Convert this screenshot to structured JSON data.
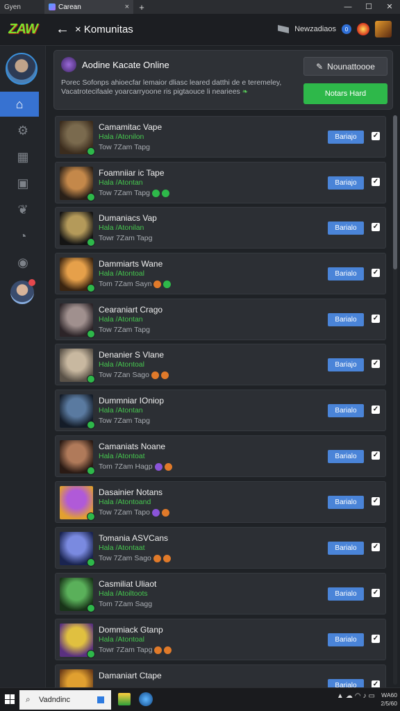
{
  "browser": {
    "tab1_label": "Gyen",
    "tab2_label": "Carean",
    "new_tab": "+",
    "close_tab": "×",
    "window_controls": [
      "—",
      "☐",
      "✕"
    ]
  },
  "app": {
    "logo_text": "ZAW",
    "page_title": "× Komunitas",
    "notifications_label": "Newzadiaos",
    "notifications_count": "0"
  },
  "banner": {
    "title": "Aodine Kacate Online",
    "description": "Porec Sofonps ahioecfar lemaior dliasc leared datthi de e teremeley, Vacatrotecifaale yoarcarryoone ris pigtaouce li neariees",
    "button_dark_label": "Nounattoooe",
    "button_green_label": "Notars Hard"
  },
  "rows": [
    {
      "name": "Camamitac Vape",
      "status": "Hala /Atonilon",
      "time": "Tow 7Zam Tapg",
      "button": "Bariajo",
      "thumb": [
        "#7a6a4e",
        "#3b2c1d"
      ],
      "emojis": []
    },
    {
      "name": "Foamniiar ic Tape",
      "status": "Hala /Atontan",
      "time": "Tow 7Zam Tapg",
      "button": "Bariajo",
      "thumb": [
        "#c4884a",
        "#2a2018"
      ],
      "emojis": [
        "#2eb84a",
        "#2eb84a"
      ]
    },
    {
      "name": "Dumaniacs Vap",
      "status": "Hala /Atonilan",
      "time": "Towr 7Zam Tapg",
      "button": "Barialo",
      "thumb": [
        "#b49a5a",
        "#141414"
      ],
      "emojis": []
    },
    {
      "name": "Dammiarts Wane",
      "status": "Hala /Atontoal",
      "time": "Tom 7Zam Sayn",
      "button": "Barialo",
      "thumb": [
        "#e6a04a",
        "#3a2410"
      ],
      "emojis": [
        "#e07a2a",
        "#2eb84a"
      ]
    },
    {
      "name": "Cearaniart Crago",
      "status": "Hala /Atontan",
      "time": "Tow 7Zam Tapg",
      "button": "Barialo",
      "thumb": [
        "#a0908e",
        "#2c2428"
      ],
      "emojis": []
    },
    {
      "name": "Denanier S Vlane",
      "status": "Hala /Atontoal",
      "time": "Tow 7Zan Sago",
      "button": "Bariajo",
      "thumb": [
        "#c8b8a0",
        "#5a5248"
      ],
      "emojis": [
        "#e07a2a",
        "#e07a2a"
      ]
    },
    {
      "name": "Dummniar IOniop",
      "status": "Hala /Atontan",
      "time": "Tow 7Zam Tapg",
      "button": "Barialo",
      "thumb": [
        "#5a7aa0",
        "#141c28"
      ],
      "emojis": []
    },
    {
      "name": "Camaniats Noane",
      "status": "Hala /Atontoat",
      "time": "Tom 7Zam Hagp",
      "button": "Barialo",
      "thumb": [
        "#b07a5a",
        "#2a1a14"
      ],
      "emojis": [
        "#8a54d8",
        "#e07a2a"
      ]
    },
    {
      "name": "Dasainier Notans",
      "status": "Hala /Atontoand",
      "time": "Tow 7Zam Tapo",
      "button": "Barialo",
      "thumb": [
        "#b05ad8",
        "#e2a030"
      ],
      "emojis": [
        "#8a54d8",
        "#e07a2a"
      ]
    },
    {
      "name": "Tomania ASVCans",
      "status": "Hala /Atontaat",
      "time": "Tow 7Zam Sago",
      "button": "Barialo",
      "thumb": [
        "#7a8ae0",
        "#1a2450"
      ],
      "emojis": [
        "#e07a2a",
        "#e07a2a"
      ]
    },
    {
      "name": "Casmiliat Uliaot",
      "status": "Hala /Atoiltoots",
      "time": "Tom 7Zam Sagg",
      "button": "Barialo",
      "thumb": [
        "#5ab05a",
        "#183418"
      ],
      "emojis": []
    },
    {
      "name": "Dommiack Gtanp",
      "status": "Hala /Atontoal",
      "time": "Towr 7Zam Tapg",
      "button": "Barialo",
      "thumb": [
        "#e0c040",
        "#5a3080"
      ],
      "emojis": [
        "#e07a2a",
        "#e07a2a"
      ]
    },
    {
      "name": "Damaniart Ctape",
      "status": "",
      "time": "",
      "button": "Barialo",
      "thumb": [
        "#e0a030",
        "#6a3a18"
      ],
      "emojis": []
    }
  ],
  "taskbar": {
    "search_text": "Vadndinc",
    "clock_time": "WA60",
    "clock_date": "2/5/60"
  }
}
